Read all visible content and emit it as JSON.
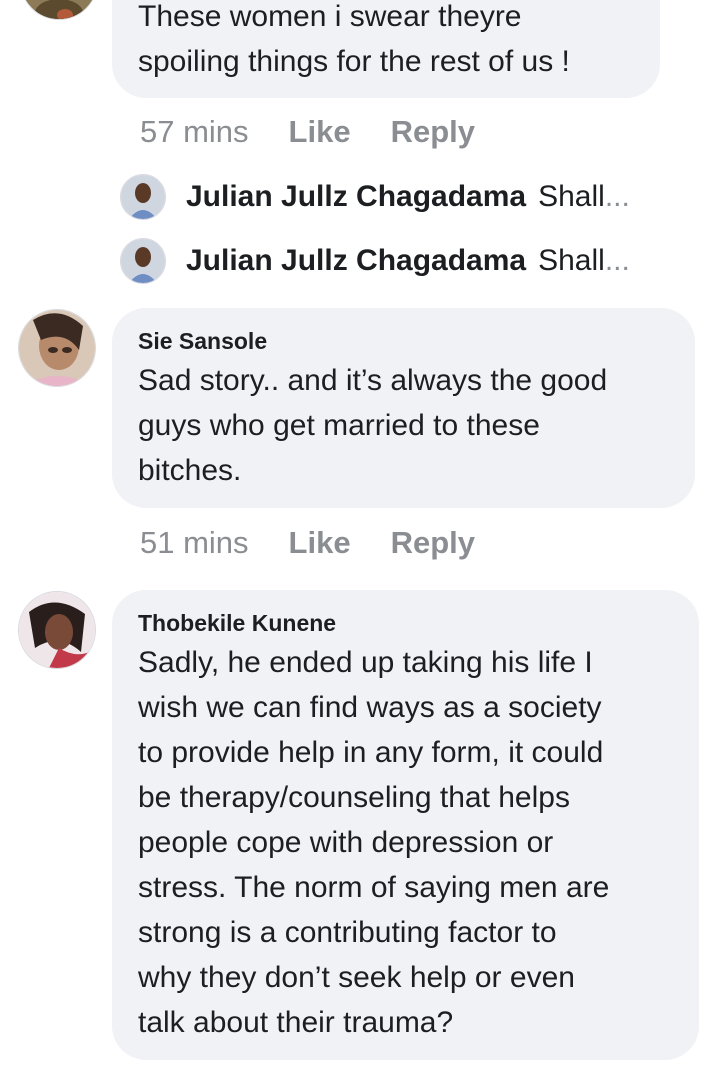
{
  "comments": [
    {
      "text_lines": [
        "These women i swear theyre",
        "spoiling things for the rest of us !"
      ],
      "time": "57 mins",
      "like_label": "Like",
      "reply_label": "Reply",
      "replies": [
        {
          "author": "Julian Jullz Chagadama",
          "preview": "Shall",
          "ellipsis": "..."
        },
        {
          "author": "Julian Jullz Chagadama",
          "preview": "Shall",
          "ellipsis": "..."
        }
      ]
    },
    {
      "author": "Sie Sansole",
      "text_lines": [
        "Sad story.. and it’s always the good",
        "guys who get married to these",
        "bitches."
      ],
      "time": "51 mins",
      "like_label": "Like",
      "reply_label": "Reply"
    },
    {
      "author": "Thobekile Kunene",
      "text_lines": [
        "Sadly, he ended up taking his life I",
        "wish we can find ways as a society",
        "to provide help in any form, it could",
        "be therapy/counseling that helps",
        "people cope with depression or",
        "stress. The norm of saying men are",
        "strong is a contributing factor to",
        "why they don’t seek help or even",
        "talk about their trauma?"
      ]
    }
  ]
}
